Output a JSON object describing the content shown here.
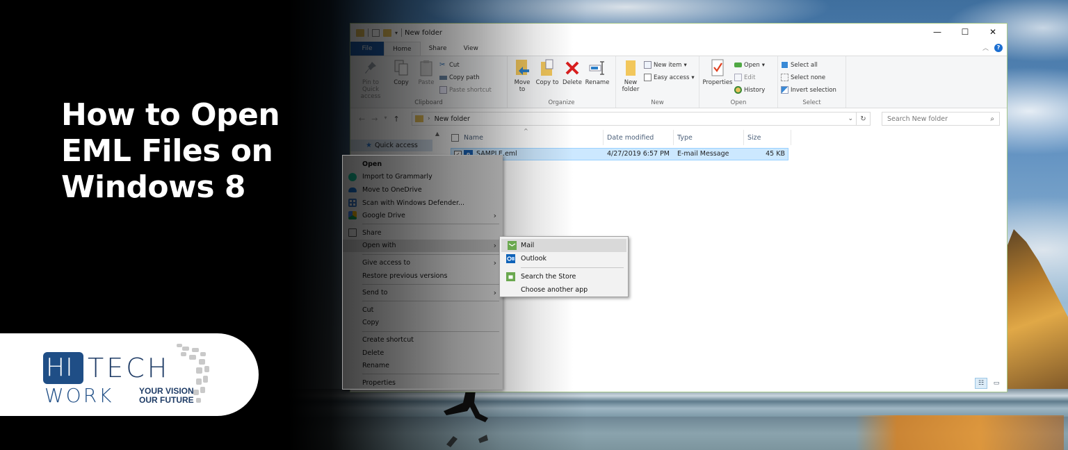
{
  "headline": {
    "lines": [
      "How to Open",
      "EML Files on",
      "Windows 8"
    ]
  },
  "logo": {
    "hi": "HI",
    "tech": "TECH",
    "work": "WORK",
    "tagline": [
      "YOUR VISION",
      "OUR FUTURE"
    ]
  },
  "explorer": {
    "title": "New folder",
    "window_controls": {
      "minimize": "—",
      "maximize": "☐",
      "close": "✕"
    },
    "tabs": [
      "File",
      "Home",
      "Share",
      "View"
    ],
    "active_tab": "Home",
    "help_icon": "?",
    "ribbon": {
      "clipboard": {
        "label": "Clipboard",
        "pin": "Pin to Quick access",
        "copy": "Copy",
        "paste": "Paste",
        "cut": "Cut",
        "copy_path": "Copy path",
        "paste_shortcut": "Paste shortcut"
      },
      "organize": {
        "label": "Organize",
        "move_to": "Move to",
        "copy_to": "Copy to",
        "delete": "Delete",
        "rename": "Rename"
      },
      "new": {
        "label": "New",
        "new_folder": "New folder",
        "new_item": "New item",
        "easy_access": "Easy access"
      },
      "open": {
        "label": "Open",
        "properties": "Properties",
        "open": "Open",
        "edit": "Edit",
        "history": "History"
      },
      "select": {
        "label": "Select",
        "select_all": "Select all",
        "select_none": "Select none",
        "invert_selection": "Invert selection"
      }
    },
    "address": {
      "path": "New folder",
      "search_placeholder": "Search New folder"
    },
    "nav_pane": {
      "quick_access": "Quick access"
    },
    "columns": [
      "Name",
      "Date modified",
      "Type",
      "Size"
    ],
    "files": [
      {
        "name": "SAMPLE.eml",
        "date_modified": "4/27/2019 6:57 PM",
        "type": "E-mail Message",
        "size": "45 KB",
        "selected": true
      }
    ]
  },
  "context_menu": {
    "items": [
      {
        "label": "Open",
        "bold": true
      },
      {
        "label": "Import to Grammarly",
        "icon": "grammarly-icon"
      },
      {
        "label": "Move to OneDrive",
        "icon": "onedrive-icon"
      },
      {
        "label": "Scan with Windows Defender...",
        "icon": "defender-icon"
      },
      {
        "label": "Google Drive",
        "icon": "google-drive-icon",
        "submenu": true
      },
      {
        "separator": true
      },
      {
        "label": "Share",
        "icon": "share-icon"
      },
      {
        "label": "Open with",
        "submenu": true,
        "highlighted": true
      },
      {
        "separator": true
      },
      {
        "label": "Give access to",
        "submenu": true
      },
      {
        "label": "Restore previous versions"
      },
      {
        "separator": true
      },
      {
        "label": "Send to",
        "submenu": true
      },
      {
        "separator": true
      },
      {
        "label": "Cut"
      },
      {
        "label": "Copy"
      },
      {
        "separator": true
      },
      {
        "label": "Create shortcut"
      },
      {
        "label": "Delete"
      },
      {
        "label": "Rename"
      },
      {
        "separator": true
      },
      {
        "label": "Properties"
      }
    ]
  },
  "open_with_submenu": {
    "items": [
      {
        "label": "Mail",
        "icon": "mail-app-icon",
        "highlighted": true
      },
      {
        "label": "Outlook",
        "icon": "outlook-icon"
      },
      {
        "separator": true
      },
      {
        "label": "Search the Store",
        "icon": "store-icon"
      },
      {
        "label": "Choose another app"
      }
    ]
  },
  "colors": {
    "file_tab": "#1c5aa8",
    "selection": "#cce8ff",
    "logo_blue": "#1f4e86",
    "window_border": "#a8c88a"
  }
}
